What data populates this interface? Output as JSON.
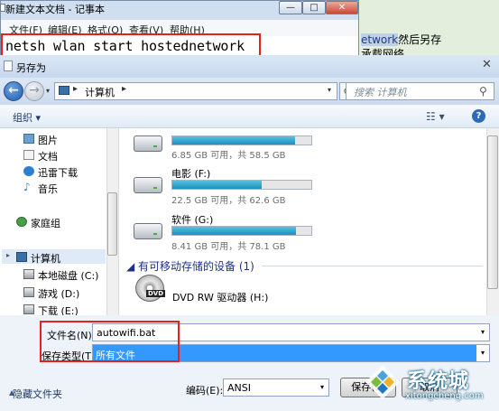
{
  "notepad": {
    "title": "新建文本文档 - 记事本",
    "menus": [
      "文件(F)",
      "编辑(E)",
      "格式(O)",
      "查看(V)",
      "帮助(H)"
    ],
    "command": "netsh wlan start hostednetwork",
    "min_glyph": "—",
    "max_glyph": "□",
    "close_glyph": "✕"
  },
  "article": {
    "highlight": "etwork",
    "line1_rest": "然后另存",
    "line2": "承载网络。"
  },
  "dialog": {
    "title": "另存为",
    "close_glyph": "✕",
    "address": {
      "location": "计算机",
      "sep": "▸",
      "dropdown": "▾"
    },
    "search_placeholder": "搜索 计算机",
    "toolbar": {
      "organize": "组织 ▾",
      "help": "?"
    },
    "nav": {
      "items": [
        {
          "label": "图片",
          "color": "#6aa0d0"
        },
        {
          "label": "文档",
          "color": "#e8e8e8"
        },
        {
          "label": "迅雷下载",
          "color": "#2f7fd1"
        },
        {
          "label": "音乐",
          "color": "#3d86c9"
        },
        {
          "label": "家庭组",
          "color": "#45a047"
        },
        {
          "label": "计算机",
          "color": "#3b6fa8"
        },
        {
          "label": "本地磁盘 (C:)",
          "color": "#9aa2ab"
        },
        {
          "label": "游戏 (D:)",
          "color": "#9aa2ab"
        },
        {
          "label": "下载 (E:)",
          "color": "#9aa2ab"
        }
      ]
    },
    "drives": [
      {
        "name": "",
        "info": "6.85 GB 可用，共 58.5 GB",
        "used_fraction": 0.88
      },
      {
        "name": "电影 (F:)",
        "info": "22.5 GB 可用，共 62.6 GB",
        "used_fraction": 0.64
      },
      {
        "name": "软件 (G:)",
        "info": "8.41 GB 可用，共 78.1 GB",
        "used_fraction": 0.89
      }
    ],
    "removable_header": "◢ 有可移动存储的设备 (1)",
    "dvd": {
      "badge": "DVD",
      "name": "DVD RW 驱动器 (H:)"
    },
    "form": {
      "filename_label": "文件名(N):",
      "filename_value": "autowifi.bat",
      "filetype_label": "保存类型(T):",
      "filetype_value": "所有文件",
      "dropdown": "▾"
    },
    "bottom": {
      "hide_folders": "隐藏文件夹",
      "hide_glyph": "▲",
      "encoding_label": "编码(E):",
      "encoding_value": "ANSI",
      "save": "保存(S)",
      "cancel": "取消"
    }
  },
  "watermark": {
    "brand": "系统城",
    "url": "xitongcheng.com"
  }
}
